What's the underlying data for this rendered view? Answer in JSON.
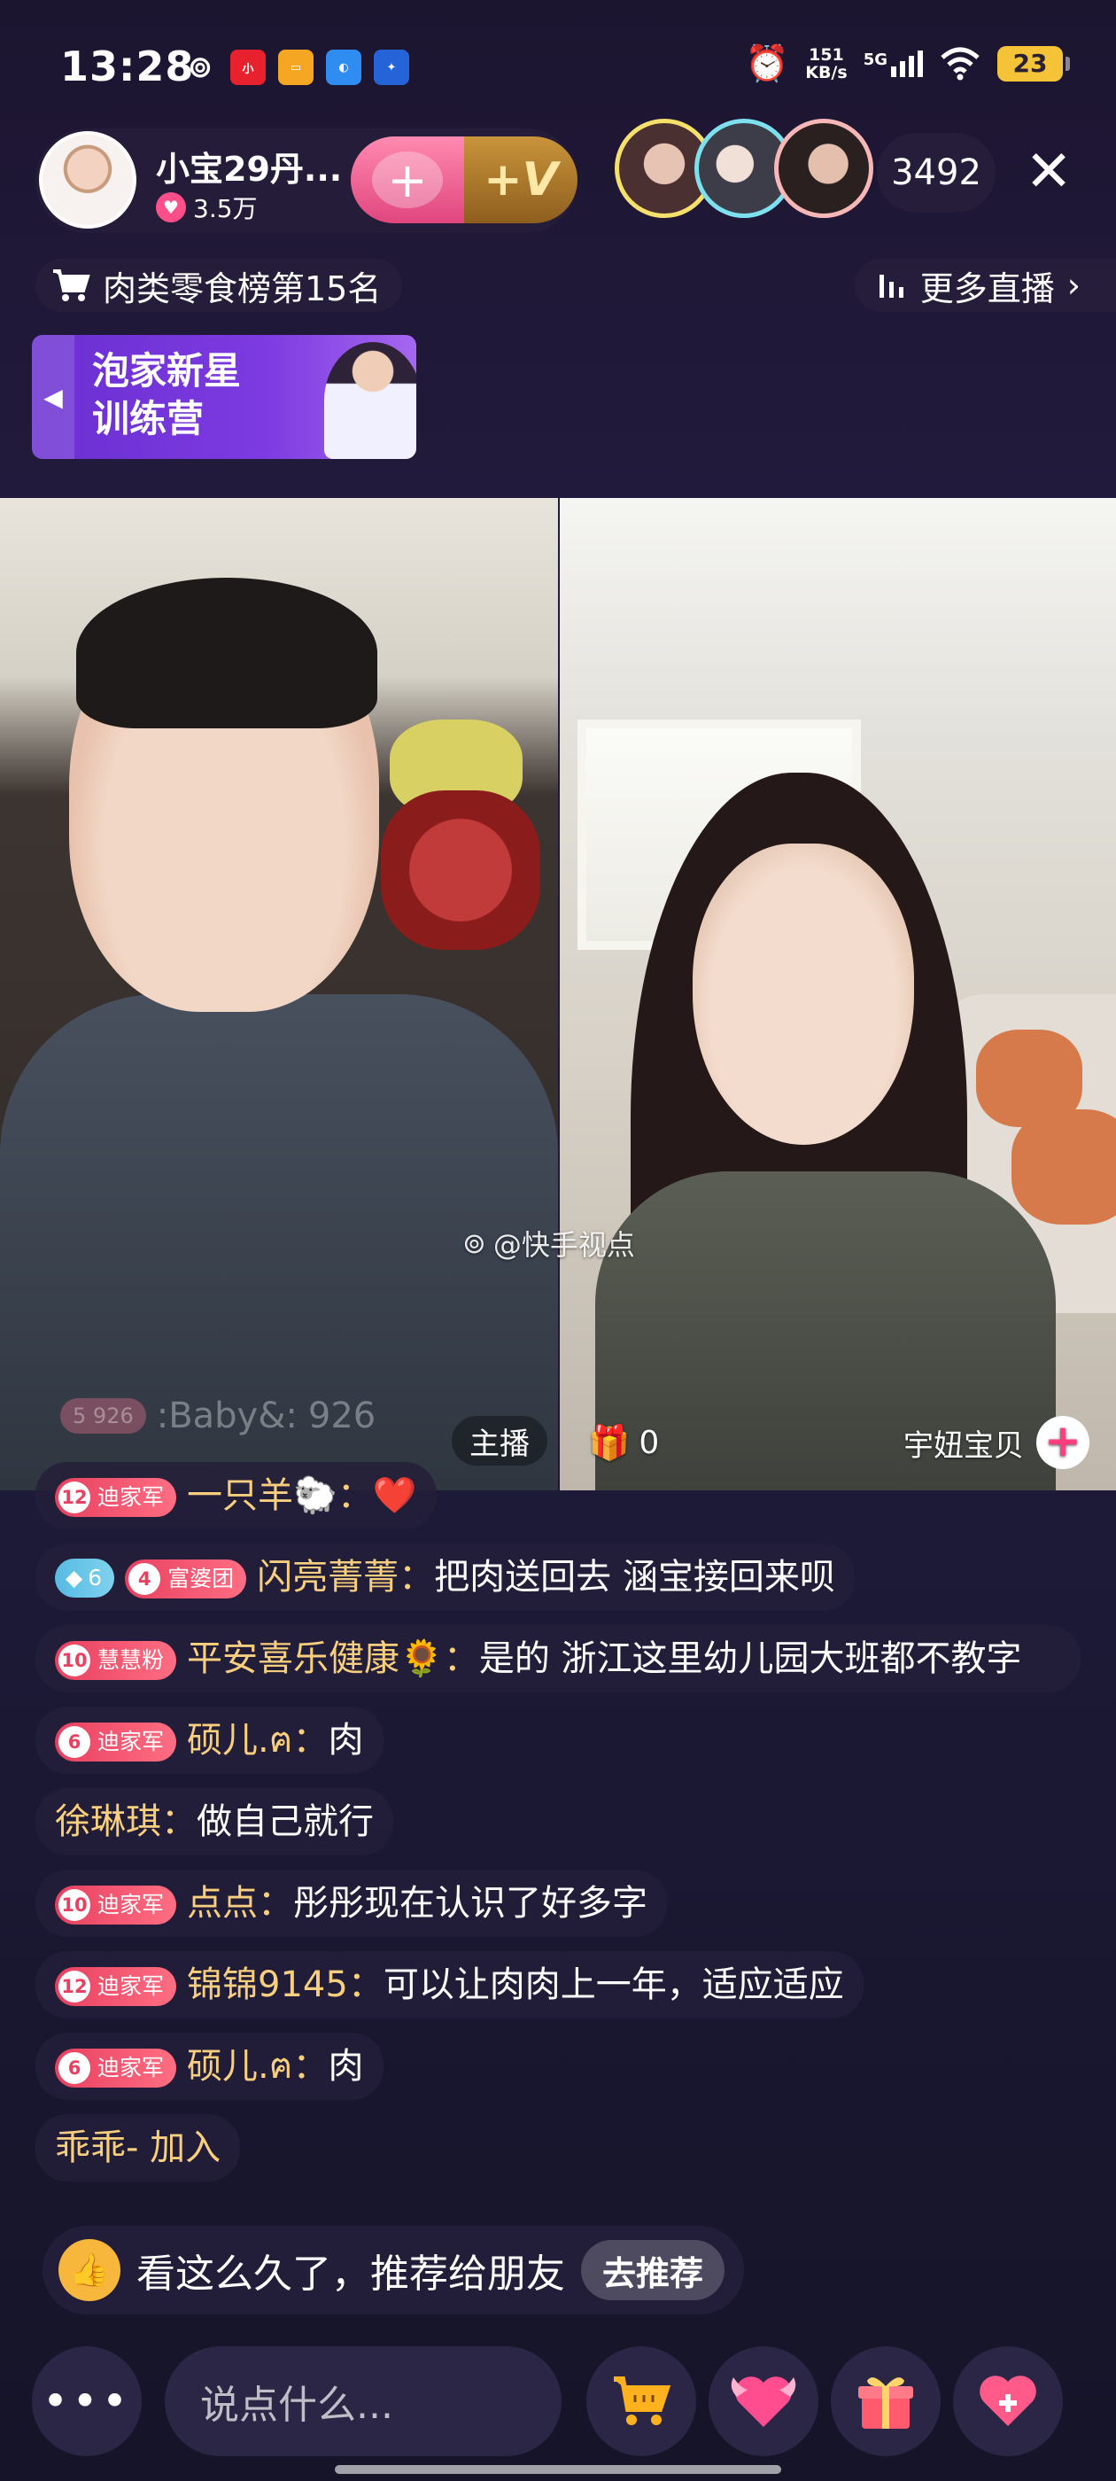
{
  "status_bar": {
    "time": "13:28",
    "net_speed": "151",
    "net_unit": "KB/s",
    "signal": "5G",
    "battery": "23",
    "app_icons": [
      "weibo-icon",
      "xiaohongshu-icon",
      "notes-icon",
      "browser-icon",
      "bank-icon"
    ]
  },
  "host": {
    "name": "小宝29丹...",
    "fans": "3.5万"
  },
  "follow": {
    "heart_label": "+",
    "vip_label": "+V"
  },
  "viewers": {
    "count": "3492"
  },
  "rank": {
    "label": "肉类零食榜第15名"
  },
  "more_live": {
    "label": "更多直播"
  },
  "banner": {
    "line1": "泡家新星",
    "line2": "训练营"
  },
  "video": {
    "watermark": "@快手视点",
    "host_tag": "主播",
    "gift_count": "0",
    "guest_name": "宇妞宝贝",
    "faded_comment": {
      "badge_level": "5",
      "badge_text": "926",
      "user": ":Baby&:",
      "text": "926"
    }
  },
  "chat": [
    {
      "level": "12",
      "fanclub": "迪家军",
      "user": "一只羊🐑",
      "text": "❤️"
    },
    {
      "diamond": "6",
      "level": "4",
      "fanclub": "富婆团",
      "user": "闪亮菁菁",
      "text": "把肉送回去 涵宝接回来呗"
    },
    {
      "level": "10",
      "fanclub": "慧慧粉",
      "user": "平安喜乐健康🌻",
      "text": "是的 浙江这里幼儿园大班都不教字"
    },
    {
      "level": "6",
      "fanclub": "迪家军",
      "user": "硕儿.ฅ",
      "text": "肉"
    },
    {
      "user": "徐琳琪",
      "text": "做自己就行"
    },
    {
      "level": "10",
      "fanclub": "迪家军",
      "user": "点点",
      "text": "彤彤现在认识了好多字"
    },
    {
      "level": "12",
      "fanclub": "迪家军",
      "user": "锦锦9145",
      "text": "可以让肉肉上一年，适应适应"
    },
    {
      "level": "6",
      "fanclub": "迪家军",
      "user": "硕儿.ฅ",
      "text": "肉"
    },
    {
      "user": "乖乖-",
      "text": "加入"
    }
  ],
  "recommend": {
    "text": "看这么久了，推荐给朋友",
    "button": "去推荐"
  },
  "bottom_bar": {
    "more": "•••",
    "input_placeholder": "说点什么..."
  },
  "colors": {
    "accent_pink": "#ff3d7f",
    "username_gold": "#f8cf7e",
    "badge_red": "#e8405f",
    "battery_yellow": "#f5c338"
  }
}
